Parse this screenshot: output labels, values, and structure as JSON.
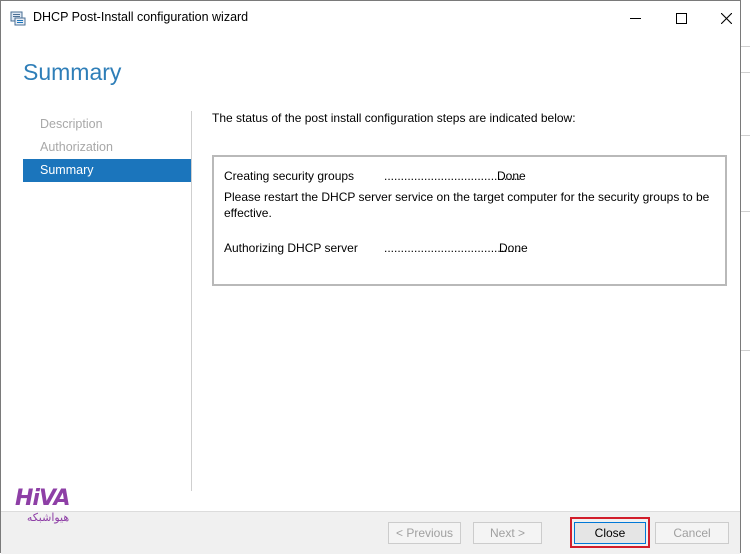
{
  "window": {
    "title": "DHCP Post-Install configuration wizard"
  },
  "header": {
    "title": "Summary"
  },
  "nav": {
    "items": [
      {
        "label": "Description",
        "state": "disabled"
      },
      {
        "label": "Authorization",
        "state": "disabled"
      },
      {
        "label": "Summary",
        "state": "active"
      }
    ]
  },
  "content": {
    "intro": "The status of the post install configuration steps are indicated below:",
    "steps": [
      {
        "label": "Creating security groups",
        "dots": ".........................................",
        "status": "Done"
      },
      {
        "label": "Authorizing DHCP server",
        "dots": ".........................................",
        "status": "Done"
      }
    ],
    "note": "Please restart the DHCP server service on the target computer for the security groups to be effective."
  },
  "footer": {
    "previous_label": "< Previous",
    "next_label": "Next >",
    "close_label": "Close",
    "cancel_label": "Cancel"
  },
  "logo": {
    "top": "HiVA",
    "bottom": "هیواشبکه"
  },
  "colors": {
    "accent": "#1b75bc",
    "header": "#2e7eb8",
    "highlight": "#d21d2a",
    "brand": "#8e3fa6"
  }
}
